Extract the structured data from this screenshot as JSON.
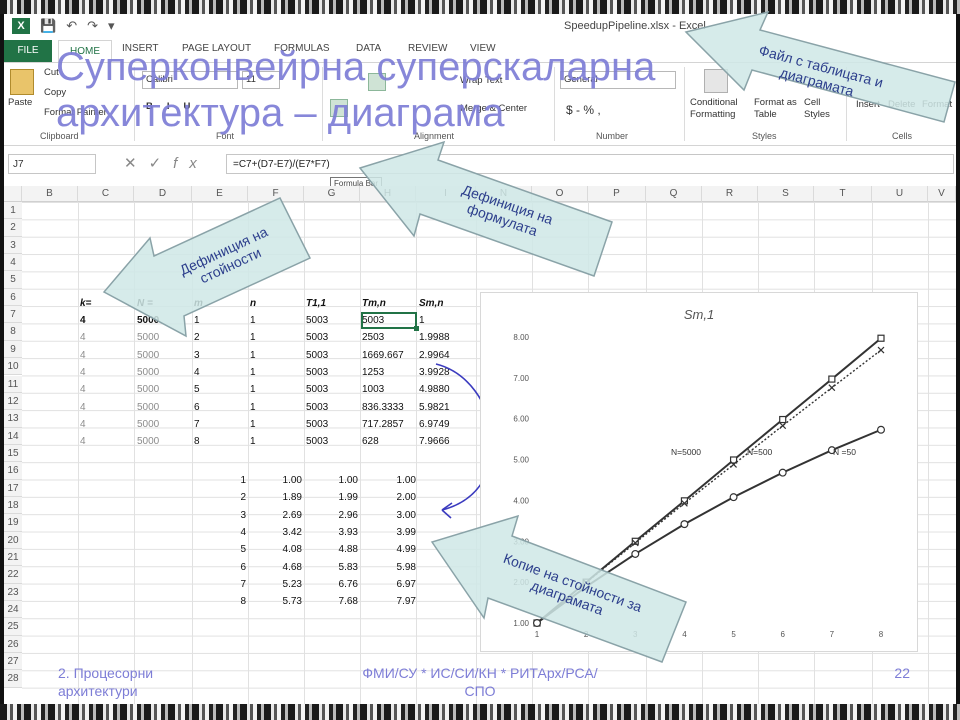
{
  "window": {
    "title": "SpeedupPipeline.xlsx - Excel"
  },
  "ribbon_tabs": [
    "FILE",
    "HOME",
    "INSERT",
    "PAGE LAYOUT",
    "FORMULAS",
    "DATA",
    "REVIEW",
    "VIEW"
  ],
  "ribbon": {
    "paste": "Paste",
    "cut": "Cut",
    "copy": "Copy",
    "format_painter": "Format Painter",
    "clipboard_group": "Clipboard",
    "font_name": "Calibri",
    "font_size": "11",
    "font_group": "Font",
    "wrap_text": "Wrap Text",
    "merge_center": "Merge & Center",
    "alignment_group": "Alignment",
    "number_format": "General",
    "number_symbols": "$ - % ,",
    "number_group": "Number",
    "conditional_formatting": "Conditional Formatting",
    "format_as_table": "Format as Table",
    "cell_styles": "Cell Styles",
    "styles_group": "Styles",
    "insert": "Insert",
    "delete": "Delete",
    "format": "Format",
    "cells_group": "Cells"
  },
  "formula_bar": {
    "name_box": "J7",
    "formula": "=C7+(D7-E7)/(E7*F7)",
    "tooltip": "Formula Bar"
  },
  "columns": [
    "B",
    "C",
    "D",
    "E",
    "F",
    "G",
    "H",
    "I",
    "N",
    "O",
    "P",
    "Q",
    "R",
    "S",
    "T",
    "U",
    "V"
  ],
  "rows": [
    "1",
    "2",
    "3",
    "4",
    "5",
    "6",
    "7",
    "8",
    "9",
    "10",
    "11",
    "12",
    "13",
    "14",
    "15",
    "16",
    "17",
    "18",
    "19",
    "20",
    "21",
    "22",
    "23",
    "24",
    "25",
    "26",
    "27",
    "28"
  ],
  "table": {
    "headers": {
      "k": "k=",
      "N": "N =",
      "m": "m",
      "n": "n",
      "T11": "T1,1",
      "Tmn": "Tm,n",
      "Smn": "Sm,n"
    },
    "rows": [
      {
        "k": "4",
        "N": "5000",
        "m": "1",
        "n": "1",
        "T11": "5003",
        "Tmn": "5003",
        "Smn": "1"
      },
      {
        "k": "4",
        "N": "5000",
        "m": "2",
        "n": "1",
        "T11": "5003",
        "Tmn": "2503",
        "Smn": "1.9988"
      },
      {
        "k": "4",
        "N": "5000",
        "m": "3",
        "n": "1",
        "T11": "5003",
        "Tmn": "1669.667",
        "Smn": "2.9964"
      },
      {
        "k": "4",
        "N": "5000",
        "m": "4",
        "n": "1",
        "T11": "5003",
        "Tmn": "1253",
        "Smn": "3.9928"
      },
      {
        "k": "4",
        "N": "5000",
        "m": "5",
        "n": "1",
        "T11": "5003",
        "Tmn": "1003",
        "Smn": "4.9880"
      },
      {
        "k": "4",
        "N": "5000",
        "m": "6",
        "n": "1",
        "T11": "5003",
        "Tmn": "836.3333",
        "Smn": "5.9821"
      },
      {
        "k": "4",
        "N": "5000",
        "m": "7",
        "n": "1",
        "T11": "5003",
        "Tmn": "717.2857",
        "Smn": "6.9749"
      },
      {
        "k": "4",
        "N": "5000",
        "m": "8",
        "n": "1",
        "T11": "5003",
        "Tmn": "628",
        "Smn": "7.9666"
      }
    ]
  },
  "copy_table": [
    {
      "m": "1",
      "a": "1.00",
      "b": "1.00",
      "c": "1.00"
    },
    {
      "m": "2",
      "a": "1.89",
      "b": "1.99",
      "c": "2.00"
    },
    {
      "m": "3",
      "a": "2.69",
      "b": "2.96",
      "c": "3.00"
    },
    {
      "m": "4",
      "a": "3.42",
      "b": "3.93",
      "c": "3.99"
    },
    {
      "m": "5",
      "a": "4.08",
      "b": "4.88",
      "c": "4.99"
    },
    {
      "m": "6",
      "a": "4.68",
      "b": "5.83",
      "c": "5.98"
    },
    {
      "m": "7",
      "a": "5.23",
      "b": "6.76",
      "c": "6.97"
    },
    {
      "m": "8",
      "a": "5.73",
      "b": "7.68",
      "c": "7.97"
    }
  ],
  "slide": {
    "title": "Суперконвейрна суперскаларна архитектура – диаграма",
    "callout_file": "Файл с таблицата и диаграмата",
    "callout_formula": "Дефиниция на формулата",
    "callout_value": "Дефиниция на стойности",
    "callout_copy": "Копие на стойности за диаграмата",
    "footer_left": "2. Процесорни архитектури",
    "footer_center": "ФМИ/СУ * ИС/СИ/КН * РИТАрх/РСА/СПО",
    "page_number": "22",
    "accent_color": "#7d7dd6",
    "callout_fill": "#cfe7e6"
  },
  "chart_data": {
    "type": "line",
    "title": "Sm,1",
    "x": [
      1,
      2,
      3,
      4,
      5,
      6,
      7,
      8
    ],
    "ylim": [
      1.0,
      8.0
    ],
    "yticks": [
      "1.00",
      "2.00",
      "3.00",
      "4.00",
      "5.00",
      "6.00",
      "7.00",
      "8.00"
    ],
    "xticks": [
      "1",
      "2",
      "3",
      "4",
      "5",
      "6",
      "7",
      "8"
    ],
    "series": [
      {
        "name": "N=5000",
        "values": [
          1.0,
          2.0,
          3.0,
          3.99,
          4.99,
          5.98,
          6.97,
          7.97
        ],
        "marker": "square",
        "style": "solid"
      },
      {
        "name": "N=500",
        "values": [
          1.0,
          1.99,
          2.96,
          3.93,
          4.88,
          5.83,
          6.76,
          7.68
        ],
        "marker": "x",
        "style": "dotted"
      },
      {
        "name": "N =50",
        "values": [
          1.0,
          1.89,
          2.69,
          3.42,
          4.08,
          4.68,
          5.23,
          5.73
        ],
        "marker": "circle",
        "style": "solid"
      }
    ]
  }
}
